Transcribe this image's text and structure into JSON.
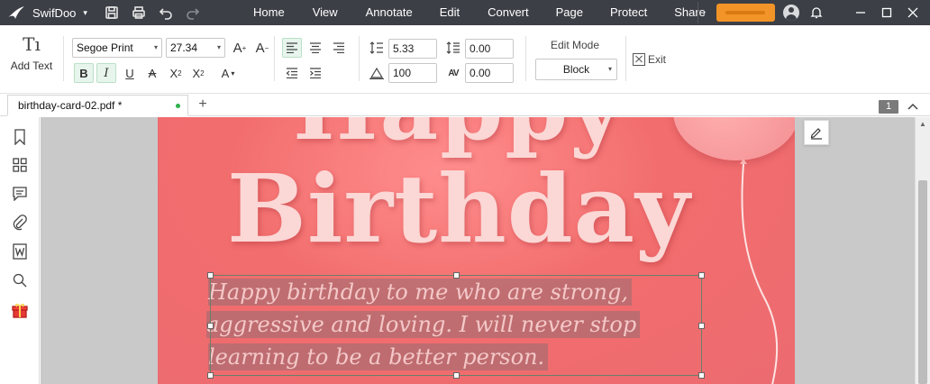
{
  "app": {
    "name": "SwifDoo",
    "caret": "▾"
  },
  "menu": {
    "items": [
      "Home",
      "View",
      "Annotate",
      "Edit",
      "Convert",
      "Page",
      "Protect",
      "Share"
    ],
    "scroll_glyph": "›"
  },
  "ribbon": {
    "add_text": {
      "icon_glyph": "Tı",
      "label": "Add Text"
    },
    "font_family": "Segoe Print",
    "font_size": "27.34",
    "grow_font": "A",
    "shrink_font": "A",
    "bold": "B",
    "italic": "I",
    "underline": "U",
    "strike": "A",
    "superscript_base": "X",
    "superscript_mark": "2",
    "subscript_base": "X",
    "subscript_mark": "2",
    "text_color": "A",
    "caret": "▾",
    "line_spacing": "5.33",
    "paragraph_spacing": "0.00",
    "scale": "100",
    "char_spacing": "0.00",
    "edit_mode": {
      "label": "Edit Mode",
      "value": "Block"
    },
    "exit_label": "Exit"
  },
  "tabs": {
    "document": "birthday-card-02.pdf *",
    "new_tab": "+",
    "page_badge": "1"
  },
  "document": {
    "line1": "Happy",
    "line2": "Birthday",
    "message": [
      "Happy birthday to me who are strong,",
      "aggressive and loving. I will never stop",
      "learning to be a better person."
    ]
  },
  "colors": {
    "titlebar": "#3c3f46",
    "accent_orange": "#f29427",
    "card_background": "#f26d6d",
    "headline_text": "#fbd7d5",
    "active_toggle": "#e7f5ec"
  },
  "icons": {
    "sidebar": [
      "bookmark-icon",
      "thumbnails-icon",
      "comment-icon",
      "attachment-icon",
      "word-convert-icon",
      "search-icon",
      "gift-icon"
    ],
    "toolbar": [
      "save-icon",
      "print-icon",
      "undo-icon",
      "redo-icon"
    ]
  }
}
